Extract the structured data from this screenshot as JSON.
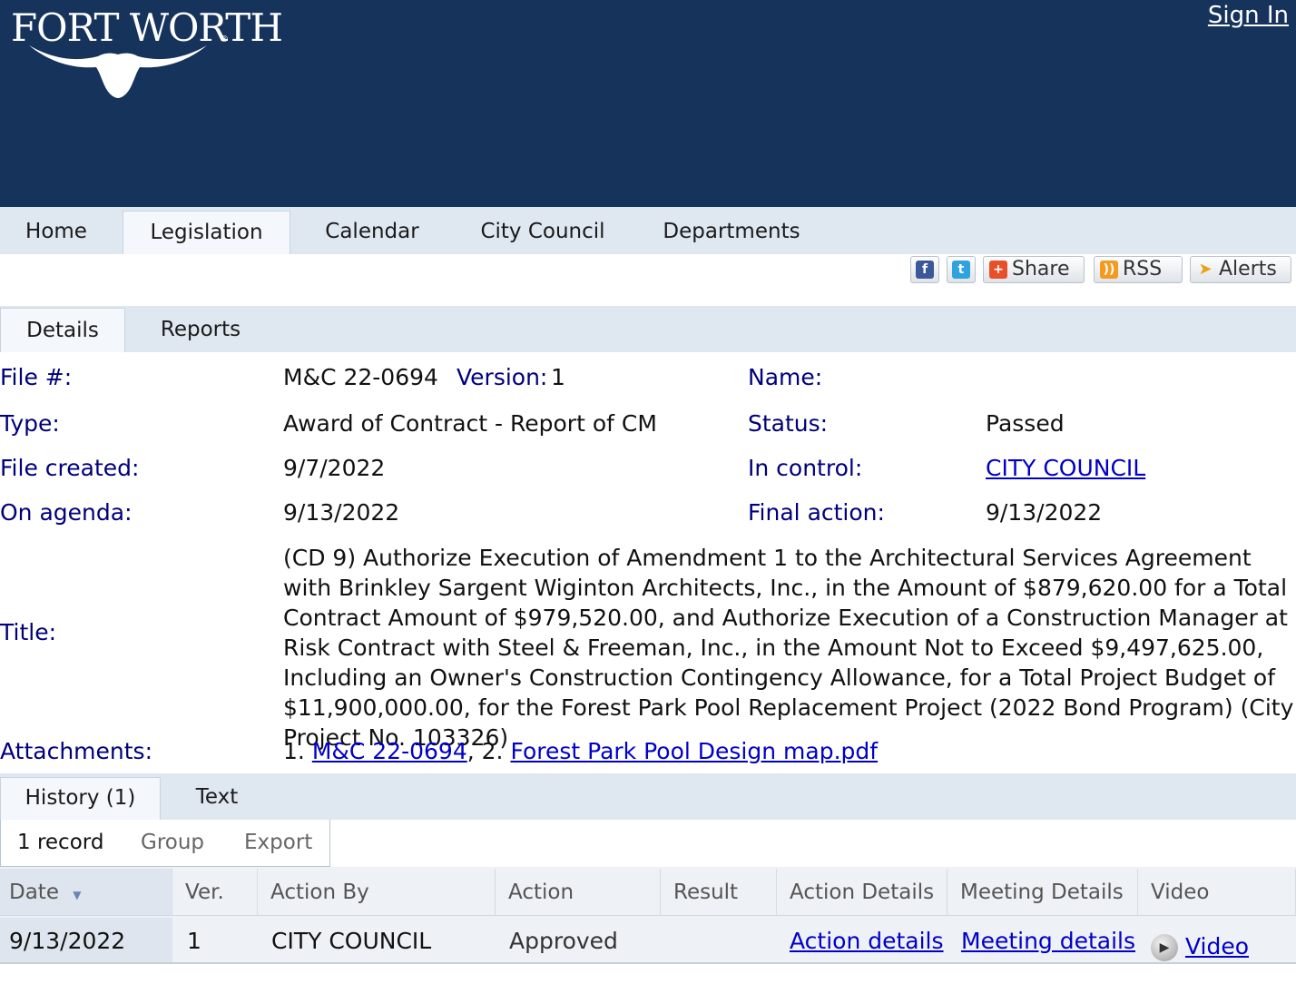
{
  "header": {
    "logo_text": "FORT WORTH",
    "logo_reg": "®",
    "signin": "Sign In"
  },
  "topnav": {
    "tabs": [
      {
        "label": "Home"
      },
      {
        "label": "Legislation",
        "active": true
      },
      {
        "label": "Calendar"
      },
      {
        "label": "City Council"
      },
      {
        "label": "Departments"
      }
    ]
  },
  "social": {
    "facebook": "f",
    "twitter": "t",
    "share": "Share",
    "rss": "RSS",
    "alerts": "Alerts"
  },
  "subnav": {
    "tabs": [
      {
        "label": "Details",
        "active": true
      },
      {
        "label": "Reports"
      }
    ]
  },
  "details": {
    "file_label": "File #:",
    "file_value": "M&C 22-0694",
    "version_label": "Version:",
    "version_value": "1",
    "name_label": "Name:",
    "type_label": "Type:",
    "type_value": "Award of Contract - Report of CM",
    "status_label": "Status:",
    "status_value": "Passed",
    "created_label": "File created:",
    "created_value": "9/7/2022",
    "control_label": "In control:",
    "control_value": "CITY COUNCIL",
    "agenda_label": "On agenda:",
    "agenda_value": "9/13/2022",
    "final_label": "Final action:",
    "final_value": "9/13/2022",
    "title_label": "Title:",
    "title_value": "(CD 9) Authorize Execution of Amendment 1 to the Architectural Services Agreement with Brinkley Sargent Wiginton Architects, Inc., in the Amount of $879,620.00 for a Total Contract Amount of $979,520.00, and Authorize Execution of a Construction Manager at Risk Contract with Steel & Freeman, Inc., in the Amount Not to Exceed $9,497,625.00, Including an Owner's Construction Contingency Allowance, for a Total Project Budget of $11,900,000.00, for the Forest Park Pool Replacement Project (2022 Bond Program) (City Project No. 103326)",
    "attachments_label": "Attachments:",
    "attachment_1_num": "1.",
    "attachment_1": "M&C 22-0694",
    "attachment_2_num": ", 2.",
    "attachment_2": "Forest Park Pool Design map.pdf"
  },
  "histnav": {
    "tabs": [
      {
        "label": "History (1)",
        "active": true
      },
      {
        "label": "Text"
      }
    ]
  },
  "toolbar": {
    "records": "1 record",
    "group": "Group",
    "export": "Export"
  },
  "history": {
    "columns": [
      "Date",
      "Ver.",
      "Action By",
      "Action",
      "Result",
      "Action Details",
      "Meeting Details",
      "Video"
    ],
    "rows": [
      [
        "9/13/2022",
        "1",
        "CITY COUNCIL",
        "Approved",
        "",
        "Action details",
        "Meeting details",
        "Video"
      ]
    ]
  }
}
